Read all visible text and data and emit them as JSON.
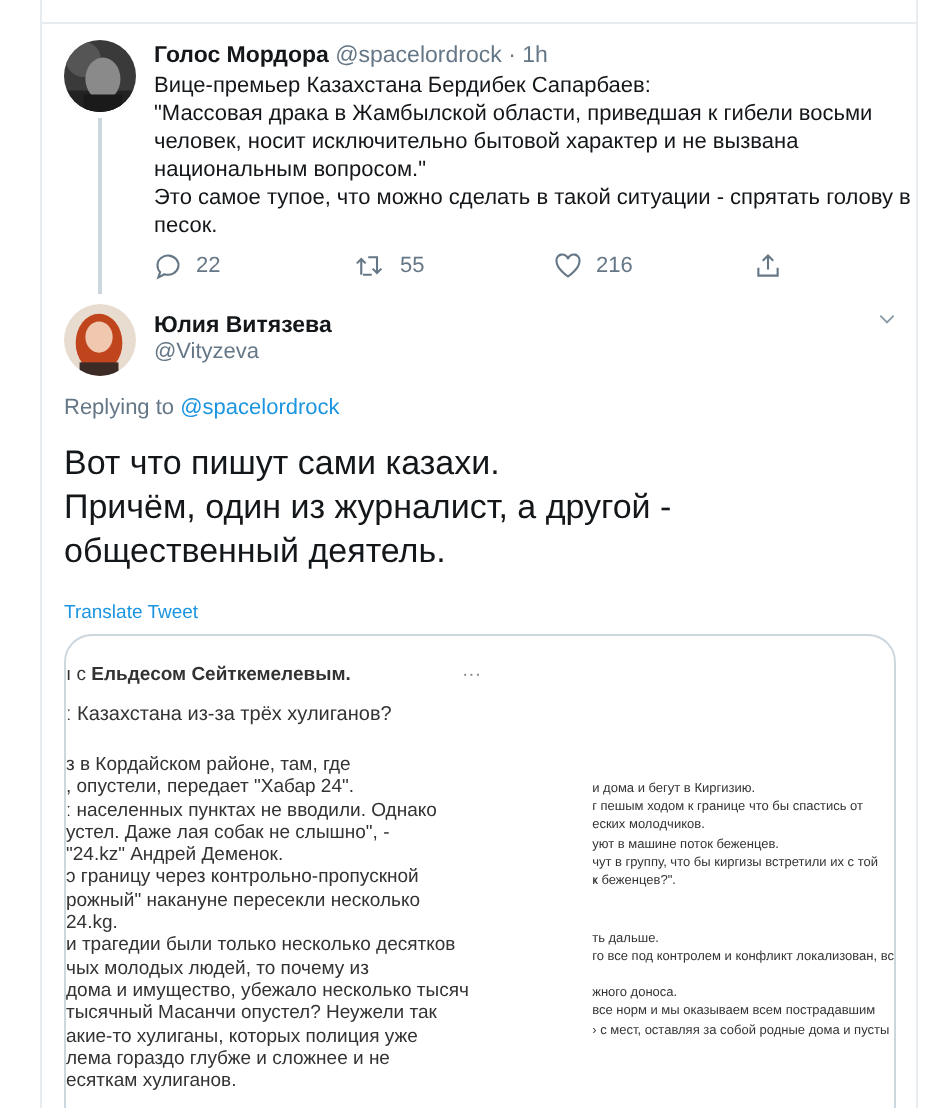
{
  "parent_tweet": {
    "avatar": {
      "kind": "picture"
    },
    "name": "Голос Мордора",
    "handle": "@spacelordrock",
    "separator": "·",
    "time": "1h",
    "lines": [
      "Вице-премьер Казахстана Бердибек Сапарбаев:",
      "\"Массовая драка в Жамбылской области, приведшая к гибели восьми человек, носит исключительно бытовой характер и не вызвана национальным вопросом.\"",
      "Это самое тупое, что можно сделать в такой ситуации - спрятать голову в песок."
    ],
    "actions": [
      {
        "kind": "reply",
        "count": "22"
      },
      {
        "kind": "retweet",
        "count": "55"
      },
      {
        "kind": "like",
        "count": "216"
      },
      {
        "kind": "share"
      }
    ]
  },
  "tweet": {
    "avatar": {
      "kind": "picture"
    },
    "name": "Юлия Витязева",
    "handle": "@Vityzeva",
    "replying_label": "Replying to",
    "replying_to": "@spacelordrock",
    "lines": [
      "Вот что пишут сами казахи.",
      "Причём, один из журналист, а другой - общественный деятель."
    ],
    "translate": "Translate Tweet",
    "attached_image": {
      "heading_prefix": "ı с ",
      "heading_name": "Ельдесом Сейткемелевым.",
      "more": "···",
      "question": "ː Казахстана из-за трёх хулиганов?",
      "left_lines": [
        "з в Кордайском районе, там, где",
        ", опустели, передает \"Хабар 24\".",
        "ː населенных пунктах не вводили. Однако",
        "устел. Даже лая собак не слышно\", -",
        "\"24.kz\" Андрей Деменок.",
        "ɔ границу через контрольно-пропускной",
        "рожный\" накануне пересекли несколько",
        "24.kg.",
        "и трагедии были только несколько десятков",
        "чых молодых людей, то почему из",
        "дома и имущество, убежало несколько тысяч",
        "тысячный Масанчи опустел?  Неужели так",
        "акие-то хулиганы, которых полиция уже",
        "лема гораздо глубже и сложнее и не",
        "есяткам хулиганов."
      ],
      "right_lines_top": [
        "и дома и бегут в Киргизию.",
        "г пешым ходом к границе что бы спастись от",
        "еских молодчиков.",
        "уют в машине поток беженцев.",
        "чут в группу, что бы киргизы встретили их с той",
        "ҝ беженцев?\"."
      ],
      "right_lines_middle": [
        "ть дальше.",
        "го все под контролем и конфликт локализован, вс"
      ],
      "right_lines_bottom": [
        "жного доноса.",
        "все норм и мы оказываем всем пострадавшим",
        "› с мест, оставляя за собой родные дома и пусты"
      ]
    }
  }
}
